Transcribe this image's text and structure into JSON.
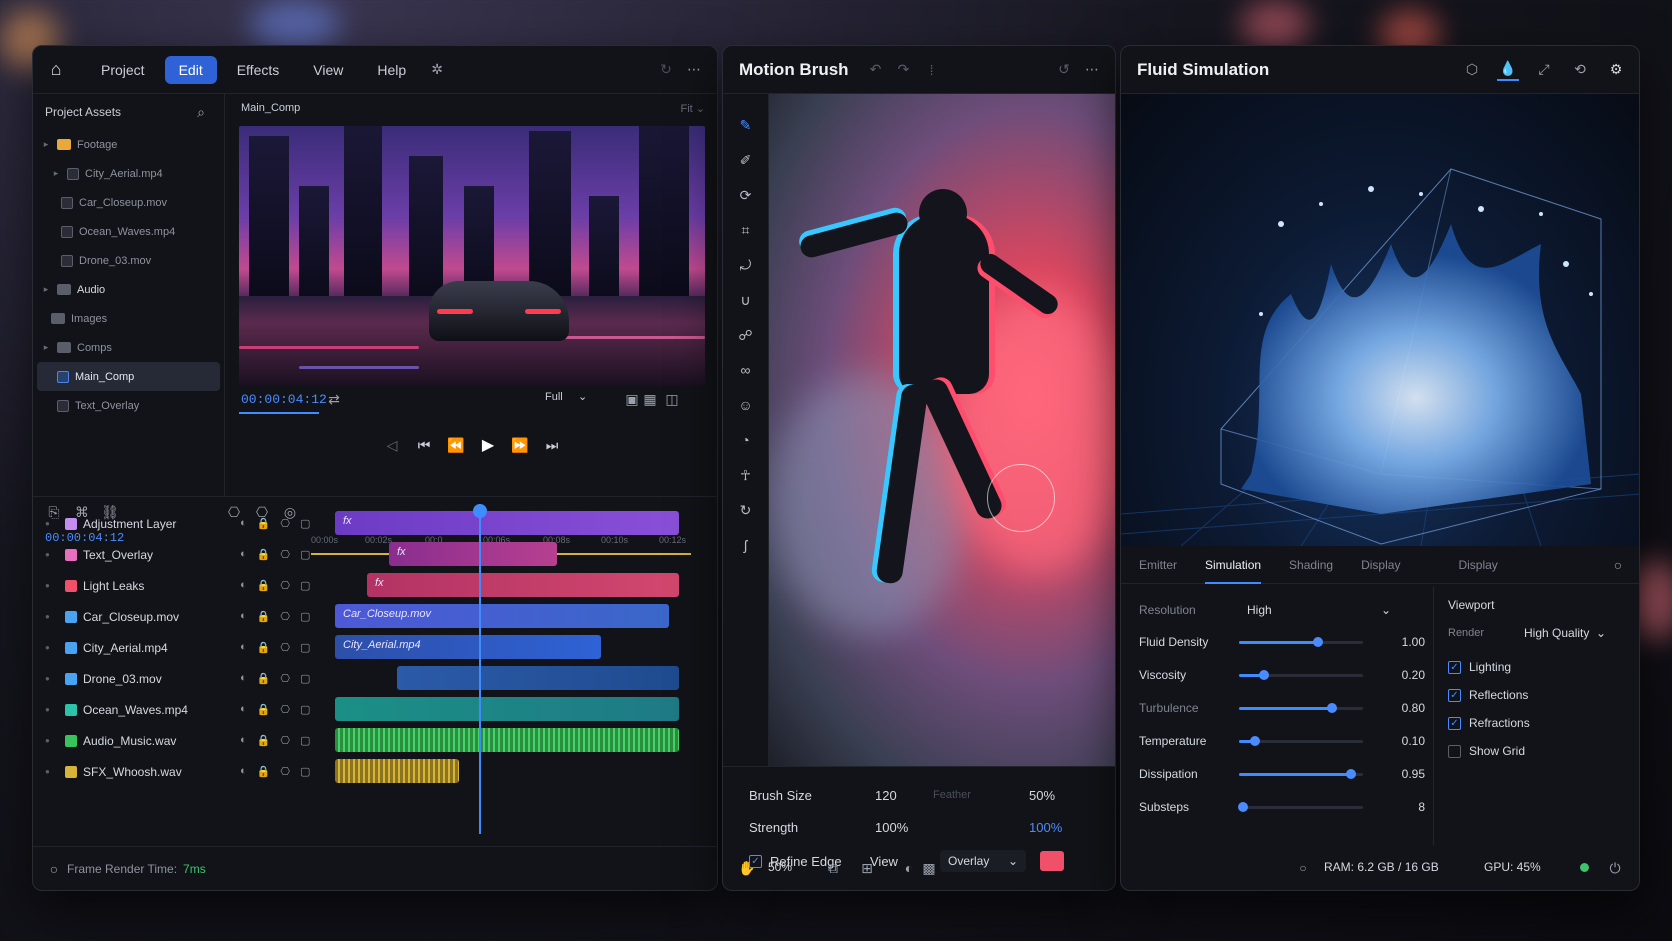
{
  "colors": {
    "accent": "#3f8cff",
    "bg": "#121318",
    "overlay_swatch": "#f0506a"
  },
  "editor": {
    "menu": [
      "Project",
      "Edit",
      "Effects",
      "View",
      "Help"
    ],
    "active_menu": "Edit",
    "assets": {
      "title": "Project Assets",
      "items": [
        {
          "label": "Footage",
          "type": "folder"
        },
        {
          "label": "City_Aerial.mp4",
          "type": "file"
        },
        {
          "label": "Car_Closeup.mov",
          "type": "file"
        },
        {
          "label": "Ocean_Waves.mp4",
          "type": "file"
        },
        {
          "label": "Drone_03.mov",
          "type": "file"
        },
        {
          "label": "Audio",
          "type": "folder"
        },
        {
          "label": "Images",
          "type": "folder"
        },
        {
          "label": "Comps",
          "type": "folder"
        },
        {
          "label": "Main_Comp",
          "type": "comp"
        },
        {
          "label": "Text_Overlay",
          "type": "comp"
        }
      ]
    },
    "comp": {
      "name": "Main_Comp",
      "fit": "Fit",
      "timecode": "00:00:04:12",
      "resolution": "Full"
    },
    "timeline": {
      "timecode": "00:00:04:12",
      "ruler": [
        "00:00s",
        "00:02s",
        "00:0",
        "00:06s",
        "00:08s",
        "00:10s",
        "00:12s"
      ],
      "tracks": [
        {
          "name": "Adjustment Layer",
          "color": "#c58cf2"
        },
        {
          "name": "Text_Overlay",
          "color": "#e86fc0"
        },
        {
          "name": "Light Leaks",
          "color": "#f0506a"
        },
        {
          "name": "Car_Closeup.mov",
          "color": "#4aa3f0"
        },
        {
          "name": "City_Aerial.mp4",
          "color": "#4aa3f0"
        },
        {
          "name": "Drone_03.mov",
          "color": "#4aa3f0"
        },
        {
          "name": "Ocean_Waves.mp4",
          "color": "#2cc4a8"
        },
        {
          "name": "Audio_Music.wav",
          "color": "#37c45a"
        },
        {
          "name": "SFX_Whoosh.wav",
          "color": "#d6b43a"
        }
      ],
      "clips": {
        "adjustment": "fx",
        "text": "fx",
        "leaks": "fx",
        "car": "Car_Closeup.mov",
        "city": "City_Aerial.mp4"
      }
    },
    "status": {
      "label": "Frame Render Time:",
      "value": "7ms"
    }
  },
  "motion_brush": {
    "title": "Motion Brush",
    "brush_size_label": "Brush Size",
    "brush_size": "120",
    "feather_label": "Feather",
    "feather": "50%",
    "strength_label": "Strength",
    "strength": "100%",
    "strength2": "100%",
    "refine_edge_label": "Refine Edge",
    "view_label": "View",
    "view_mode": "Overlay"
  },
  "bottombar": {
    "zoom": "50%",
    "ram": "RAM: 6.2 GB / 16 GB",
    "gpu": "GPU: 45%"
  },
  "fluid": {
    "title": "Fluid Simulation",
    "tabs": [
      "Emitter",
      "Simulation",
      "Shading",
      "Display",
      "Display"
    ],
    "active_tab": "Simulation",
    "resolution_label": "Resolution",
    "resolution": "High",
    "params": [
      {
        "label": "Fluid Density",
        "value": 1.0,
        "display": "1.00",
        "level": 0.64
      },
      {
        "label": "Viscosity",
        "value": 0.2,
        "display": "0.20",
        "level": 0.2
      },
      {
        "label": "Turbulence",
        "value": 0.8,
        "display": "0.80",
        "level": 0.75
      },
      {
        "label": "Temperature",
        "value": 0.1,
        "display": "0.10",
        "level": 0.13
      },
      {
        "label": "Dissipation",
        "value": 0.95,
        "display": "0.95",
        "level": 0.9
      },
      {
        "label": "Substeps",
        "value": 8,
        "display": "8",
        "level": 0.03
      }
    ],
    "viewport": {
      "title": "Viewport",
      "render_label": "Render",
      "render": "High Quality",
      "options": [
        {
          "label": "Lighting",
          "checked": true
        },
        {
          "label": "Reflections",
          "checked": true
        },
        {
          "label": "Refractions",
          "checked": true
        },
        {
          "label": "Show Grid",
          "checked": false
        }
      ]
    }
  }
}
